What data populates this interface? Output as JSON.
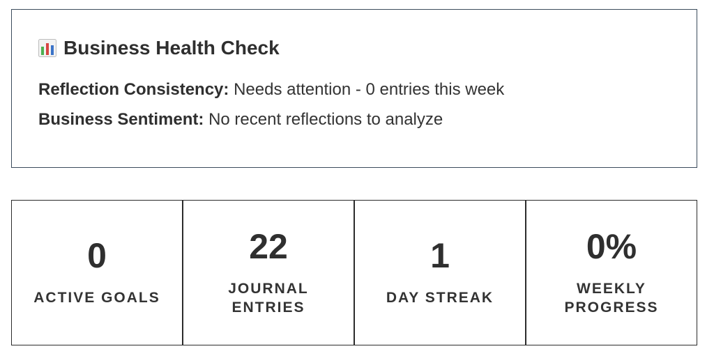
{
  "health_check": {
    "icon": "bar-chart-icon",
    "title": "Business Health Check",
    "consistency_label": "Reflection Consistency:",
    "consistency_value": "Needs attention - 0 entries this week",
    "sentiment_label": "Business Sentiment:",
    "sentiment_value": "No recent reflections to analyze"
  },
  "stats": [
    {
      "value": "0",
      "label": "ACTIVE GOALS"
    },
    {
      "value": "22",
      "label": "JOURNAL ENTRIES"
    },
    {
      "value": "1",
      "label": "DAY STREAK"
    },
    {
      "value": "0%",
      "label": "WEEKLY PROGRESS"
    }
  ],
  "colors": {
    "card_border": "#3b4b5c",
    "text": "#2f2f2f",
    "icon_green": "#4caf50",
    "icon_red": "#d64541",
    "icon_blue": "#3b73c8"
  }
}
